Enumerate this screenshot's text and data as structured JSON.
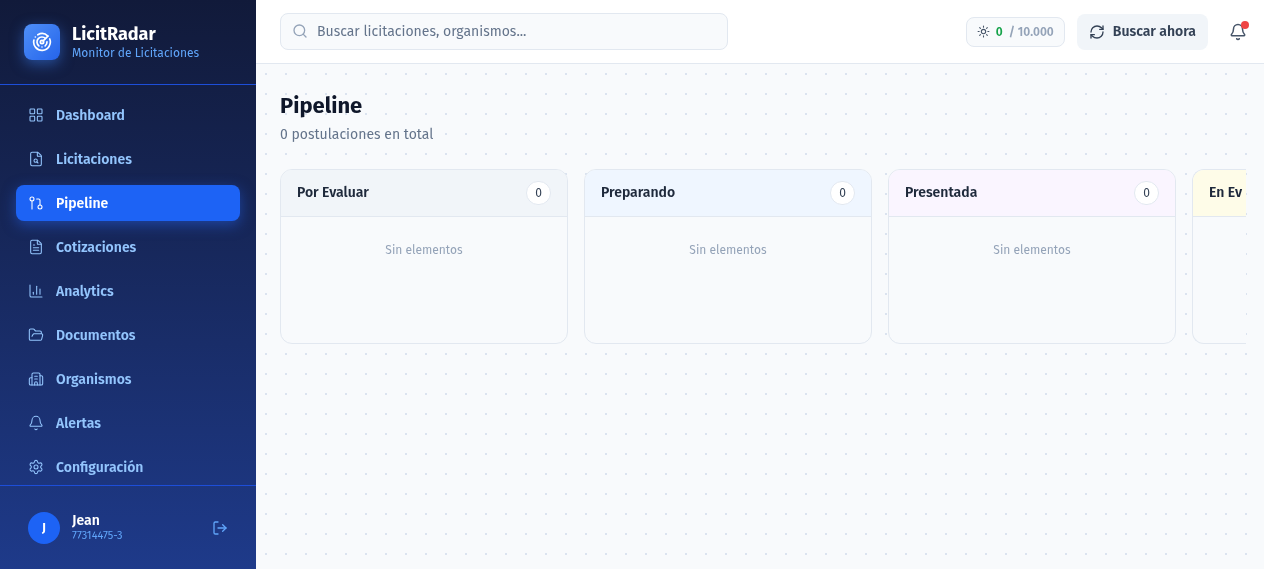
{
  "brand": {
    "name": "LicitRadar",
    "subtitle": "Monitor de Licitaciones"
  },
  "sidebar": {
    "items": [
      {
        "label": "Dashboard",
        "selected": false
      },
      {
        "label": "Licitaciones",
        "selected": false
      },
      {
        "label": "Pipeline",
        "selected": true
      },
      {
        "label": "Cotizaciones",
        "selected": false
      },
      {
        "label": "Analytics",
        "selected": false
      },
      {
        "label": "Documentos",
        "selected": false
      },
      {
        "label": "Organismos",
        "selected": false
      },
      {
        "label": "Alertas",
        "selected": false
      },
      {
        "label": "Configuración",
        "selected": false
      }
    ]
  },
  "user": {
    "initial": "J",
    "name": "Jean",
    "id": "77314475-3"
  },
  "search": {
    "placeholder": "Buscar licitaciones, organismos..."
  },
  "usage": {
    "used": "0",
    "limit": "/ 10.000"
  },
  "search_button": "Buscar ahora",
  "notifications": {
    "unread": true
  },
  "page": {
    "title": "Pipeline",
    "subtitle": "0 postulaciones en total"
  },
  "columns": [
    {
      "title": "Por Evaluar",
      "count": "0",
      "color": "#f1f5f9",
      "empty_text": "Sin elementos"
    },
    {
      "title": "Preparando",
      "count": "0",
      "color": "#eff6ff",
      "empty_text": "Sin elementos"
    },
    {
      "title": "Presentada",
      "count": "0",
      "color": "#faf5ff",
      "empty_text": "Sin elementos"
    },
    {
      "title": "En Ev",
      "color": "#fefce8"
    }
  ]
}
